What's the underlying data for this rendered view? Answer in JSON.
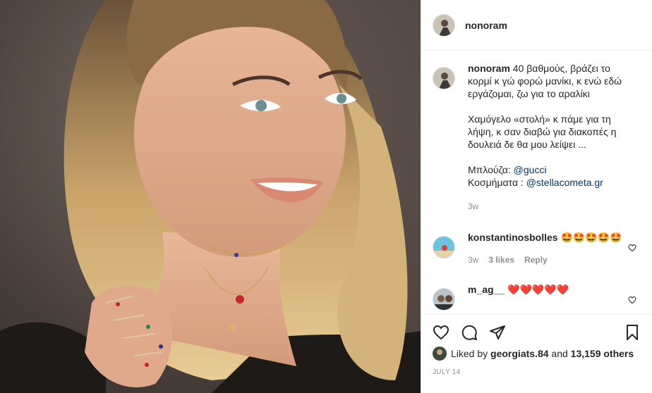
{
  "post": {
    "username": "nonoram",
    "caption": {
      "line1": "40 βαθμούς, βράζει το κορμί κ γώ φορώ μανίκι, κ ενώ εδώ εργάζομαι, ζω για το αραλίκι",
      "line2": "Χαμόγελο «στολή» κ πάμε για τη λήψη, κ σαν διαβώ για διακοπές η δουλειά δε θα μου λείψει ...",
      "shirt_label": "Μπλούζα:",
      "shirt_link": "@gucci",
      "jewelry_label": "Κοσμήματα :",
      "jewelry_link": "@stellacometa.gr",
      "time": "3w"
    },
    "comments": [
      {
        "username": "konstantinosbolles",
        "text": "🤩🤩🤩🤩🤩",
        "time": "3w",
        "likes": "3 likes",
        "reply": "Reply"
      },
      {
        "username": "m_ag__",
        "text": "❤️❤️❤️❤️❤️"
      }
    ],
    "likes": {
      "prefix": "Liked by",
      "user": "georgiats.84",
      "and": "and",
      "count": "13,159 others"
    },
    "date": "JULY 14"
  },
  "icons": {
    "like": "heart-icon",
    "comment": "comment-icon",
    "share": "share-icon",
    "save": "bookmark-icon"
  },
  "colors": {
    "link": "#00376b",
    "meta": "#8e8e8e",
    "border": "#efefef"
  }
}
